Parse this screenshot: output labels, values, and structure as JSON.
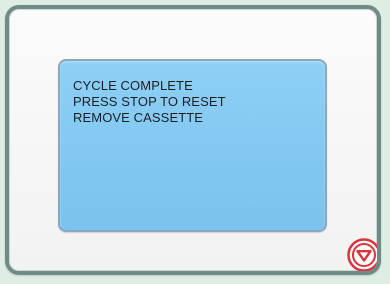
{
  "screen": {
    "lines": [
      "CYCLE COMPLETE",
      "PRESS STOP TO RESET",
      "REMOVE CASSETTE"
    ]
  },
  "controls": {
    "stop_button_icon": "stop-triangle-icon"
  },
  "colors": {
    "panel_border": "#6f8a87",
    "screen_fill": "#86ccf3",
    "stop_button": "#d9343b"
  }
}
